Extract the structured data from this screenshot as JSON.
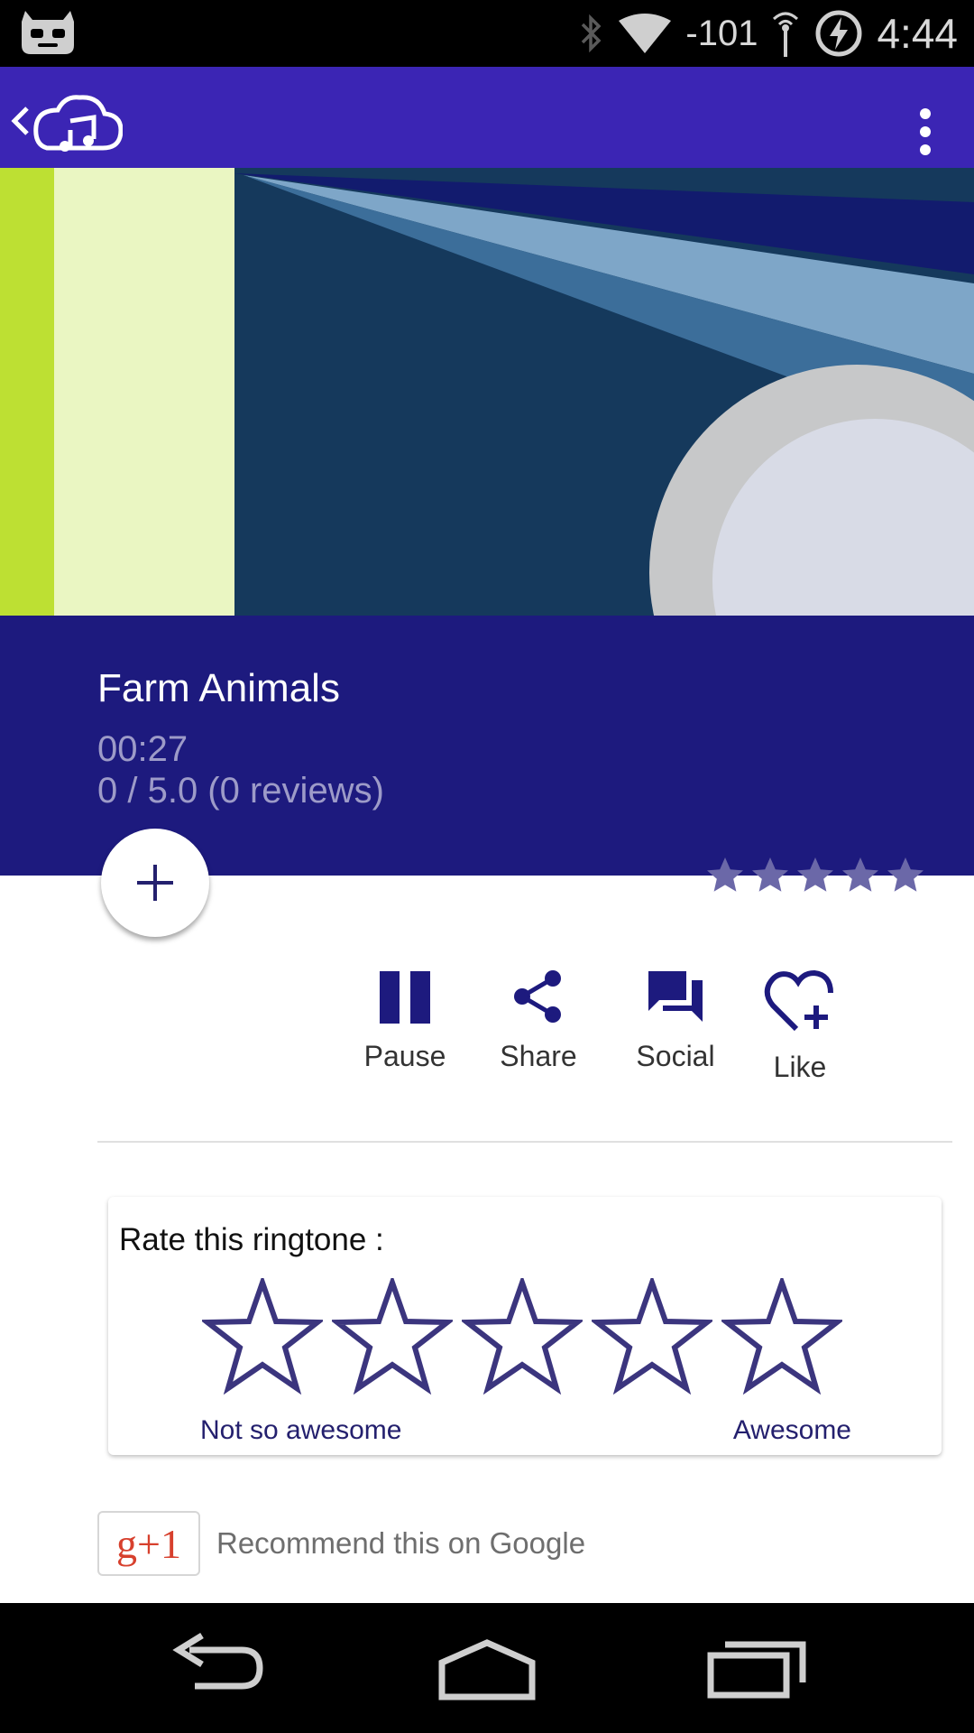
{
  "status_bar": {
    "signal_text": "-101",
    "time": "4:44",
    "icons": [
      "cyanogen-icon",
      "bluetooth-icon",
      "wifi-icon",
      "signal-icon",
      "battery-charging-icon"
    ]
  },
  "app_bar": {
    "icons": [
      "back-arrow-icon",
      "cloud-music-logo-icon",
      "more-vert-icon"
    ],
    "color": "#3b25b4"
  },
  "ringtone": {
    "title": "Farm Animals",
    "duration": "00:27",
    "rating_summary": "0 / 5.0 (0 reviews)",
    "average_stars": 0,
    "max_stars": 5,
    "panel_color": "#1d1a7e"
  },
  "fab": {
    "icon": "plus-icon"
  },
  "actions": [
    {
      "label": "Pause",
      "icon": "pause-icon"
    },
    {
      "label": "Share",
      "icon": "share-icon"
    },
    {
      "label": "Social",
      "icon": "forum-icon"
    },
    {
      "label": "Like",
      "icon": "heart-plus-icon"
    }
  ],
  "rate": {
    "title": "Rate this ringtone :",
    "low_label": "Not so awesome",
    "high_label": "Awesome",
    "selected": 0,
    "max": 5,
    "star_color": "#3b357e"
  },
  "google": {
    "button_label": "g+1",
    "text": "Recommend this on Google"
  },
  "nav_bar": {
    "icons": [
      "back-nav-icon",
      "home-nav-icon",
      "recents-nav-icon"
    ]
  }
}
